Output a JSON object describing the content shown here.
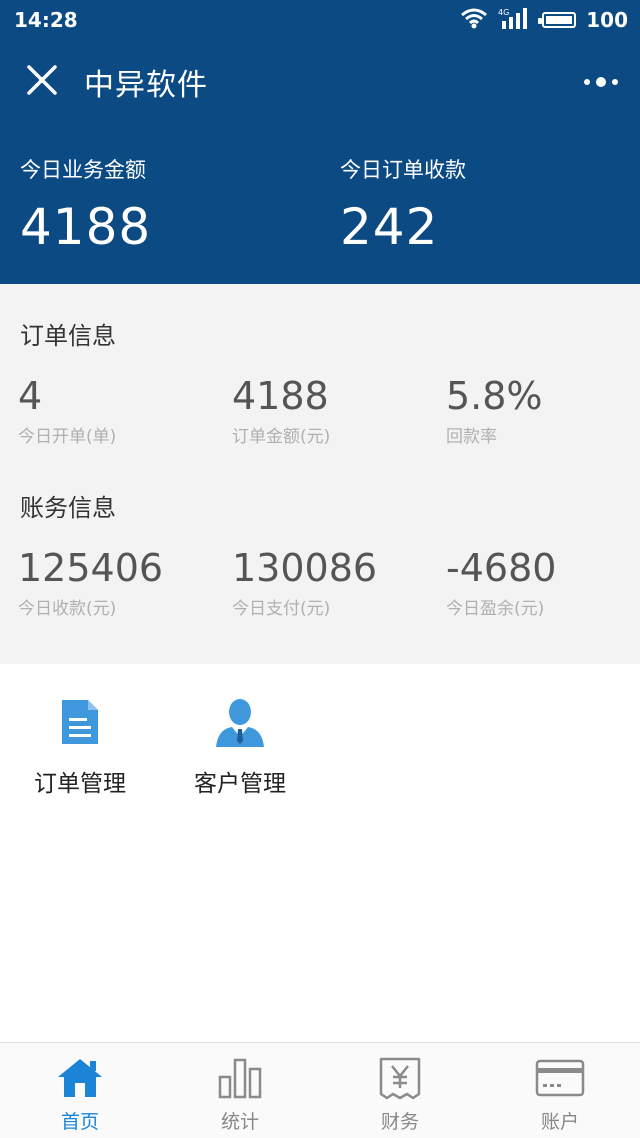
{
  "status_bar": {
    "time": "14:28",
    "network": "4G",
    "battery": "100"
  },
  "header": {
    "title": "中异软件"
  },
  "hero": {
    "left": {
      "label": "今日业务金额",
      "value": "4188"
    },
    "right": {
      "label": "今日订单收款",
      "value": "242"
    }
  },
  "order_info": {
    "title": "订单信息",
    "stats": [
      {
        "value": "4",
        "label": "今日开单(单)"
      },
      {
        "value": "4188",
        "label": "订单金额(元)"
      },
      {
        "value": "5.8%",
        "label": "回款率"
      }
    ]
  },
  "finance_info": {
    "title": "账务信息",
    "stats": [
      {
        "value": "125406",
        "label": "今日收款(元)"
      },
      {
        "value": "130086",
        "label": "今日支付(元)"
      },
      {
        "value": "-4680",
        "label": "今日盈余(元)"
      }
    ]
  },
  "menu": [
    {
      "label": "订单管理",
      "icon": "document-icon"
    },
    {
      "label": "客户管理",
      "icon": "person-icon"
    }
  ],
  "tabs": [
    {
      "label": "首页",
      "icon": "home-icon",
      "active": true
    },
    {
      "label": "统计",
      "icon": "bar-chart-icon",
      "active": false
    },
    {
      "label": "财务",
      "icon": "yen-receipt-icon",
      "active": false
    },
    {
      "label": "账户",
      "icon": "card-icon",
      "active": false
    }
  ],
  "colors": {
    "header_bg": "#0b4a83",
    "accent": "#1b84d6",
    "panel_bg": "#f3f3f3"
  }
}
